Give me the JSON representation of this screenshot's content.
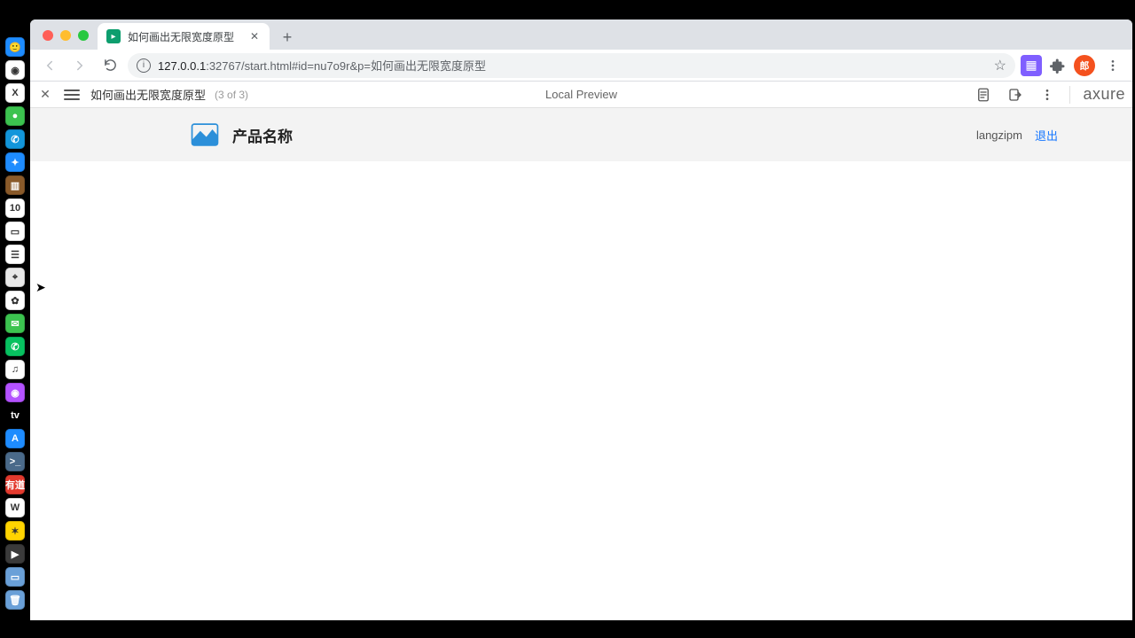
{
  "dock": {
    "items": [
      {
        "name": "finder",
        "bg": "#1e8cff",
        "glyph": "🙂"
      },
      {
        "name": "chrome",
        "bg": "#ffffff",
        "glyph": "◉"
      },
      {
        "name": "axure",
        "bg": "#ffffff",
        "glyph": "X"
      },
      {
        "name": "wechat-mini",
        "bg": "#3cc34f",
        "glyph": "●"
      },
      {
        "name": "dingtalk",
        "bg": "#1296db",
        "glyph": "✆"
      },
      {
        "name": "safari",
        "bg": "#1e8cff",
        "glyph": "✦"
      },
      {
        "name": "contacts",
        "bg": "#8a5a2a",
        "glyph": "▥"
      },
      {
        "name": "calendar",
        "bg": "#ffffff",
        "glyph": "10"
      },
      {
        "name": "notes",
        "bg": "#ffffff",
        "glyph": "▭"
      },
      {
        "name": "reminders",
        "bg": "#ffffff",
        "glyph": "☰"
      },
      {
        "name": "maps",
        "bg": "#e8e8e8",
        "glyph": "⌖"
      },
      {
        "name": "photos",
        "bg": "#ffffff",
        "glyph": "✿"
      },
      {
        "name": "messages",
        "bg": "#3cc34f",
        "glyph": "✉"
      },
      {
        "name": "wechat",
        "bg": "#07c160",
        "glyph": "✆"
      },
      {
        "name": "music",
        "bg": "#ffffff",
        "glyph": "♫"
      },
      {
        "name": "podcasts",
        "bg": "#b452ff",
        "glyph": "◉"
      },
      {
        "name": "appletv",
        "bg": "#000000",
        "glyph": "tv"
      },
      {
        "name": "appstore",
        "bg": "#1e8cff",
        "glyph": "A"
      },
      {
        "name": "terminal",
        "bg": "#4a6a8a",
        "glyph": ">_"
      },
      {
        "name": "youdao",
        "bg": "#e33a2e",
        "glyph": "有道"
      },
      {
        "name": "wps",
        "bg": "#ffffff",
        "glyph": "W"
      },
      {
        "name": "butterfly",
        "bg": "#ffd400",
        "glyph": "✶"
      },
      {
        "name": "videos",
        "bg": "#3a3a3a",
        "glyph": "▶"
      },
      {
        "name": "desktop",
        "bg": "#6aa0d8",
        "glyph": "▭"
      },
      {
        "name": "trash",
        "bg": "#6aa0d8",
        "glyph": "🗑"
      }
    ]
  },
  "browser": {
    "tab_title": "如何画出无限宽度原型",
    "url_host": "127.0.0.1",
    "url_port": ":32767",
    "url_path": "/start.html#id=nu7o9r&p=如何画出无限宽度原型",
    "avatar_initial": "郎"
  },
  "axure": {
    "page_name": "如何画出无限宽度原型",
    "page_count": "(3 of 3)",
    "center_label": "Local Preview",
    "logo": "axure"
  },
  "content": {
    "product_name": "产品名称",
    "user_name": "langzipm",
    "logout_label": "退出"
  }
}
